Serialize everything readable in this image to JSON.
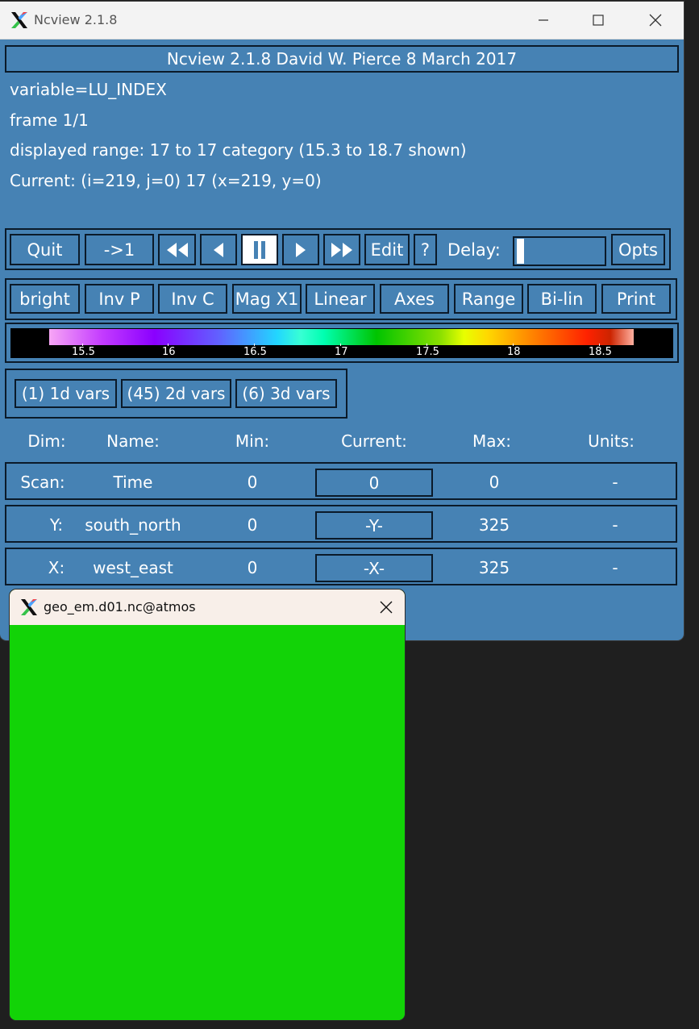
{
  "main_window": {
    "title": "Ncview 2.1.8",
    "header": "Ncview 2.1.8 David W. Pierce  8 March 2017",
    "info": {
      "variable": "variable=LU_INDEX",
      "frame": "frame 1/1",
      "range": "displayed range: 17 to 17 category (15.3 to 18.7 shown)",
      "current": "Current: (i=219, j=0) 17 (x=219, y=0)"
    },
    "controls": {
      "quit": "Quit",
      "to_first": "->1",
      "edit": "Edit",
      "help": "?",
      "delay_label": "Delay:",
      "opts": "Opts"
    },
    "options": [
      "bright",
      "Inv P",
      "Inv C",
      "Mag X1",
      "Linear",
      "Axes",
      "Range",
      "Bi-lin",
      "Print"
    ],
    "colorbar": {
      "ticks": [
        "15.5",
        "16",
        "16.5",
        "17",
        "17.5",
        "18",
        "18.5"
      ]
    },
    "var_groups": [
      "(1) 1d vars",
      "(45) 2d vars",
      "(6) 3d vars"
    ],
    "dim_table": {
      "headers": [
        "Dim:",
        "Name:",
        "Min:",
        "Current:",
        "Max:",
        "Units:"
      ],
      "rows": [
        {
          "dim": "Scan:",
          "name": "Time",
          "min": "0",
          "current": "0",
          "max": "0",
          "units": "-"
        },
        {
          "dim": "Y:",
          "name": "south_north",
          "min": "0",
          "current": "-Y-",
          "max": "325",
          "units": "-"
        },
        {
          "dim": "X:",
          "name": "west_east",
          "min": "0",
          "current": "-X-",
          "max": "325",
          "units": "-"
        }
      ]
    }
  },
  "image_window": {
    "title": "geo_em.d01.nc@atmos",
    "fill_color": "#12d307"
  },
  "colors": {
    "panel_bg": "#4682b4",
    "border": "#0b1a29"
  }
}
